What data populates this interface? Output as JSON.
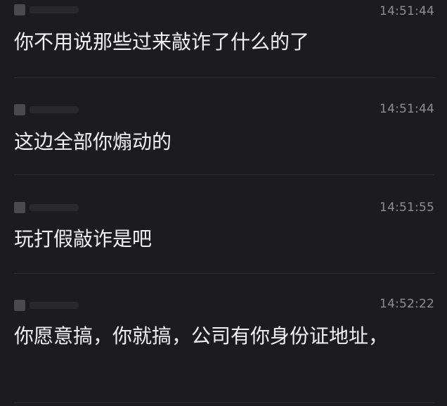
{
  "messages": [
    {
      "time": "14:51:44",
      "text": "你不用说那些过来敲诈了什么的了"
    },
    {
      "time": "14:51:44",
      "text": "这边全部你煽动的"
    },
    {
      "time": "14:51:55",
      "text": "玩打假敲诈是吧"
    },
    {
      "time": "14:52:22",
      "text": "你愿意搞，你就搞，公司有你身份证地址，"
    }
  ],
  "colors": {
    "background": "#1c1c1e",
    "message_text": "#f2f2f2",
    "timestamp": "#8e8e93",
    "divider": "#2f2f31"
  }
}
